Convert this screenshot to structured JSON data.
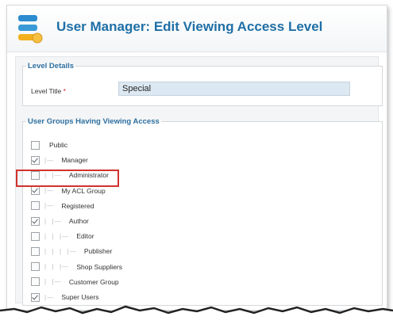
{
  "header": {
    "title": "User Manager: Edit Viewing Access Level"
  },
  "level_details": {
    "legend": "Level Details",
    "label": "Level Title",
    "required_marker": "*",
    "value": "Special"
  },
  "groups": {
    "legend": "User Groups Having Viewing Access",
    "items": [
      {
        "label": "Public",
        "checked": false,
        "prefix": ""
      },
      {
        "label": "Manager",
        "checked": true,
        "prefix": "|— "
      },
      {
        "label": "Administrator",
        "checked": false,
        "prefix": "|  |— "
      },
      {
        "label": "My ACL Group",
        "checked": true,
        "prefix": "|— "
      },
      {
        "label": "Registered",
        "checked": false,
        "prefix": "|— "
      },
      {
        "label": "Author",
        "checked": true,
        "prefix": "|  |— "
      },
      {
        "label": "Editor",
        "checked": false,
        "prefix": "|  |  |— "
      },
      {
        "label": "Publisher",
        "checked": false,
        "prefix": "|  |  |  |— "
      },
      {
        "label": "Shop Suppliers",
        "checked": false,
        "prefix": "|  |  |— "
      },
      {
        "label": "Customer Group",
        "checked": false,
        "prefix": "|  |— "
      },
      {
        "label": "Super Users",
        "checked": true,
        "prefix": "|— "
      }
    ]
  },
  "colors": {
    "title": "#1f6fa6",
    "legend": "#2d6fa0",
    "highlight": "#d2322d",
    "input_bg": "#dde9f2"
  },
  "icons": {
    "app": "user-manager-icon"
  }
}
